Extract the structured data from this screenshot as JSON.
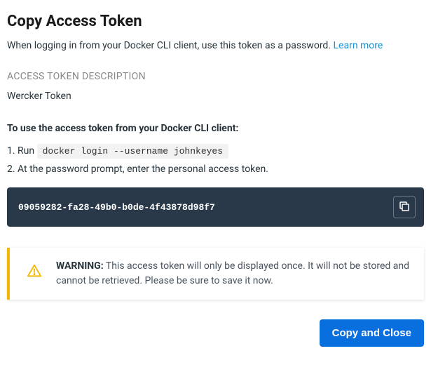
{
  "header": {
    "title": "Copy Access Token",
    "subtitle_prefix": "When logging in from your Docker CLI client, use this token as a password. ",
    "learn_more": "Learn more"
  },
  "description": {
    "label": "ACCESS TOKEN DESCRIPTION",
    "value": "Wercker Token"
  },
  "instructions": {
    "heading": "To use the access token from your Docker CLI client:",
    "step1_prefix": "1. Run ",
    "step1_code": "docker login --username johnkeyes",
    "step2": "2. At the password prompt, enter the personal access token."
  },
  "token": {
    "value": "09059282-fa28-49b0-b0de-4f43878d98f7"
  },
  "warning": {
    "label": "WARNING:",
    "text": " This access token will only be displayed once. It will not be stored and cannot be retrieved. Please be sure to save it now."
  },
  "footer": {
    "copy_close": "Copy and Close"
  }
}
